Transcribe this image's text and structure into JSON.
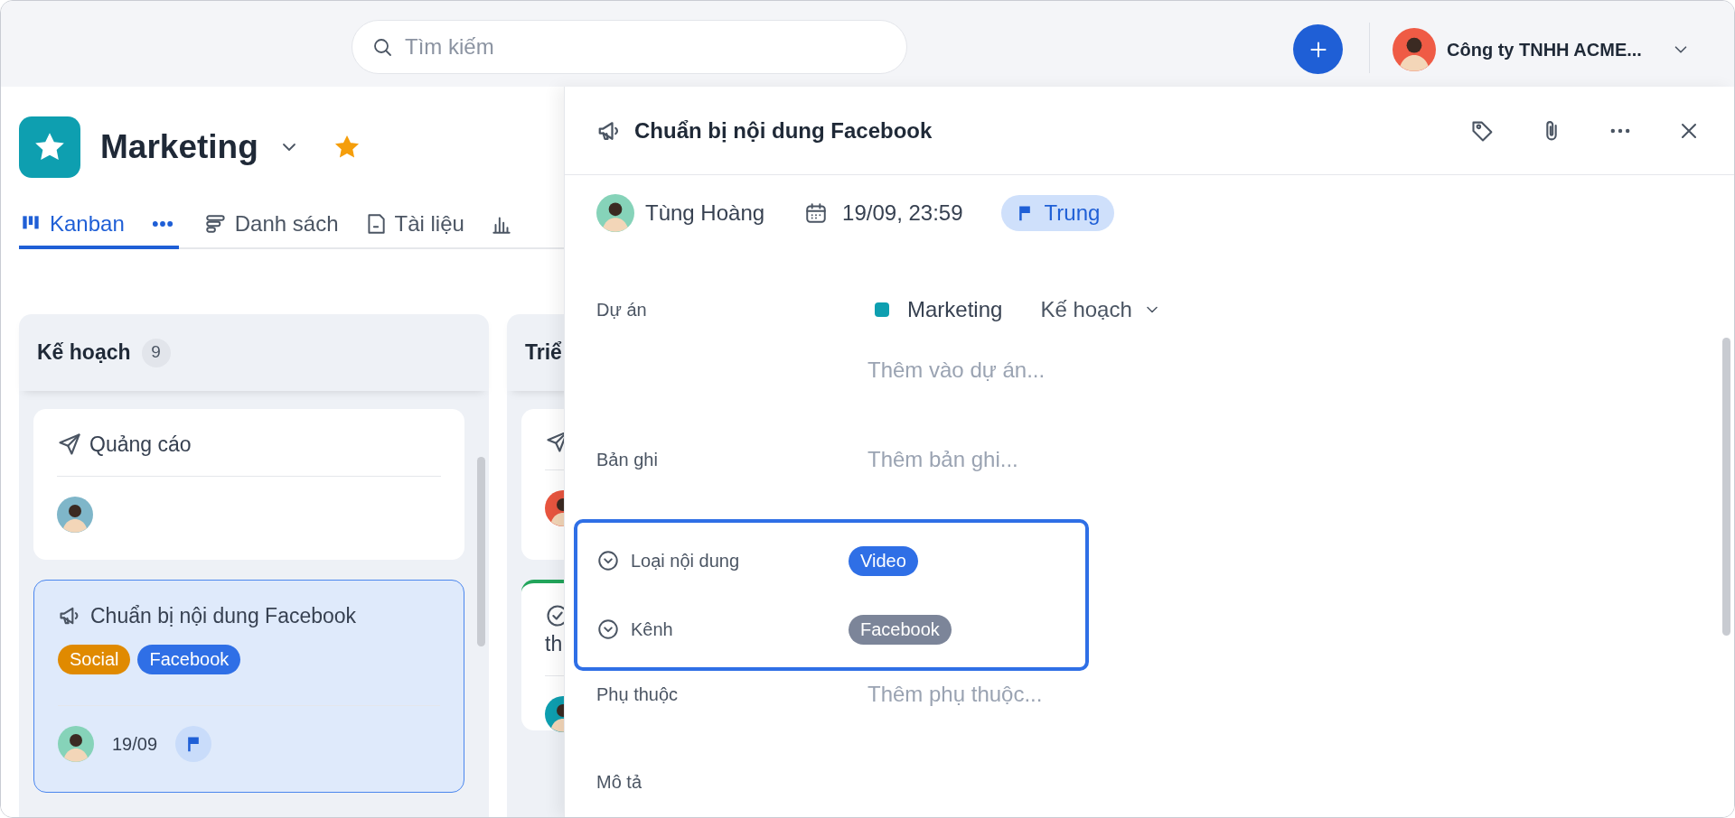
{
  "search": {
    "placeholder": "Tìm kiếm"
  },
  "account": {
    "name": "Công ty TNHH ACME..."
  },
  "project": {
    "title": "Marketing",
    "starred": true
  },
  "view_tabs": [
    {
      "label": "Kanban",
      "kind": "kanban",
      "selected": true
    },
    {
      "label": "Danh sách",
      "kind": "list",
      "selected": false
    },
    {
      "label": "Tài liệu",
      "kind": "doc",
      "selected": false
    }
  ],
  "columns": [
    {
      "title": "Kế hoạch",
      "count": "9",
      "cards": [
        {
          "title": "Quảng cáo",
          "kind": "send",
          "selected": false
        },
        {
          "title": "Chuẩn bị nội dung Facebook",
          "kind": "megaphone",
          "selected": true,
          "tags": [
            {
              "label": "Social",
              "color": "#e08a00"
            },
            {
              "label": "Facebook",
              "color": "#2f6fe6"
            }
          ],
          "date": "19/09",
          "flag": true
        }
      ]
    },
    {
      "title": "Triể",
      "cards": [
        {
          "kind": "send",
          "selected": false
        },
        {
          "title": "th",
          "kind": "check",
          "selected": false,
          "color": "#22a55b"
        }
      ]
    }
  ],
  "task": {
    "title": "Chuẩn bị nội dung Facebook",
    "assignee": "Tùng Hoàng",
    "due": "19/09, 23:59",
    "priority": "Trung",
    "fields": [
      {
        "kind": "project",
        "label": "Dự án",
        "project": "Marketing",
        "color": "#0e9fb0",
        "stage": "Kế hoạch",
        "placeholder": "Thêm vào dự án..."
      },
      {
        "kind": "input",
        "label": "Bản ghi",
        "placeholder": "Thêm bản ghi..."
      },
      {
        "kind": "tag",
        "label": "Loại nội dung",
        "value": "Video",
        "color": "#2f6fe6",
        "highlighted": true
      },
      {
        "kind": "tag",
        "label": "Kênh",
        "value": "Facebook",
        "color": "#7c8599",
        "highlighted": true
      },
      {
        "kind": "input",
        "label": "Phụ thuộc",
        "placeholder": "Thêm phụ thuộc..."
      },
      {
        "kind": "heading",
        "label": "Mô tả"
      }
    ]
  }
}
